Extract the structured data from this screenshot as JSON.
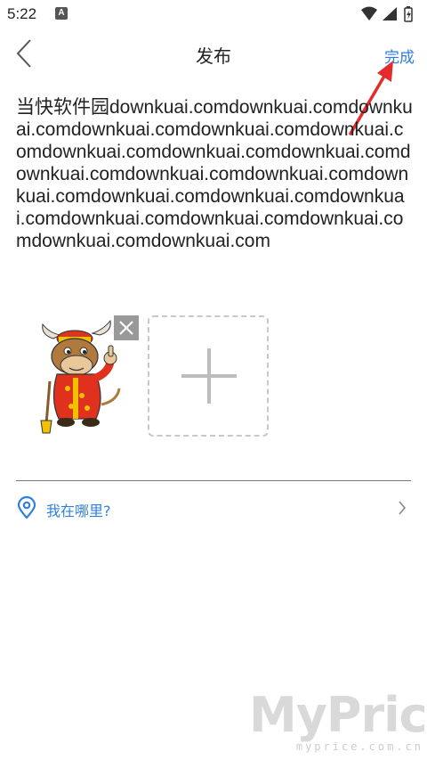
{
  "status_bar": {
    "time": "5:22",
    "notification_icon": "a-icon",
    "icons": [
      "wifi-icon",
      "signal-icon",
      "battery-icon"
    ]
  },
  "title_bar": {
    "title": "发布",
    "done_label": "完成",
    "back_icon": "chevron-left-icon"
  },
  "post": {
    "text": "当快软件园downkuai.comdownkuai.comdownkuai.comdownkuai.comdownkuai.comdownkuai.comdownkuai.comdownkuai.comdownkuai.comdownkuai.comdownkuai.comdownkuai.comdownkuai.comdownkuai.comdownkuai.comdownkuai.comdownkuai.comdownkuai.comdownkuai.comdownkuai.comdownkuai.com"
  },
  "images": {
    "items": [
      "ox-mascot-image"
    ],
    "add_icon": "plus-icon",
    "remove_icon": "close-icon"
  },
  "location": {
    "label": "我在哪里?",
    "icon": "location-pin-icon"
  },
  "watermark": {
    "logo": "MyPrice",
    "url": "myprice.com.cn"
  },
  "colors": {
    "accent": "#2f7fe0",
    "annotation": "#e52b2b"
  }
}
